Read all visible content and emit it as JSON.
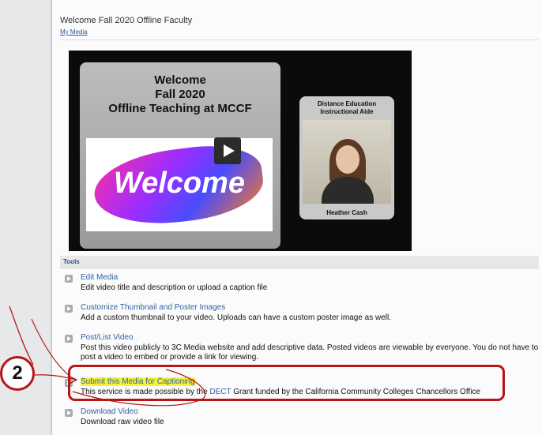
{
  "header": {
    "title": "Welcome Fall 2020 Offline Faculty",
    "my_media_link": "My Media"
  },
  "video": {
    "slide_heading_1": "Welcome",
    "slide_heading_2": "Fall 2020",
    "slide_heading_3": "Offline Teaching at MCCF",
    "welcome_art_text": "Welcome",
    "aide_title_1": "Distance Education",
    "aide_title_2": "Instructional Aide",
    "aide_name": "Heather Cash"
  },
  "tools": {
    "section_label": "Tools",
    "items": [
      {
        "label": "Edit Media",
        "description": "Edit video title and description or upload a caption file"
      },
      {
        "label": "Customize Thumbnail and Poster Images",
        "description": "Add a custom thumbnail to your video. Uploads can have a custom poster image as well."
      },
      {
        "label": "Post/List Video",
        "description": "Post this video publicly to 3C Media website and add descriptive data. Posted videos are viewable by everyone. You do not have to post a video to embed or provide a link for viewing."
      },
      {
        "label": "Submit this Media for Captioning",
        "description_prefix": "This service is made possible by the ",
        "description_link": "DECT",
        "description_suffix": " Grant funded by the California Community Colleges Chancellors Office"
      },
      {
        "label": "Download Video",
        "description": "Download raw video file"
      }
    ]
  },
  "annotation": {
    "step_number": "2",
    "color": "#b51616"
  },
  "colors": {
    "link": "#2f61a8",
    "highlight": "#f5f238"
  }
}
